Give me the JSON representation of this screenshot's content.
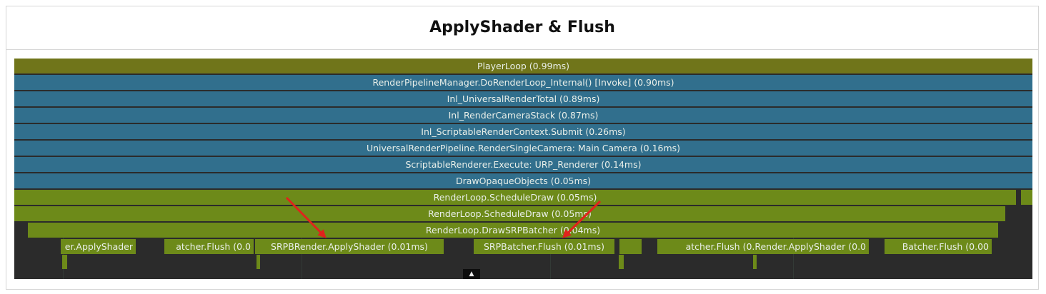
{
  "title": "ApplyShader & Flush",
  "profiler": {
    "rows": [
      {
        "label": "PlayerLoop (0.99ms)"
      },
      {
        "label": "RenderPipelineManager.DoRenderLoop_Internal() [Invoke] (0.90ms)"
      },
      {
        "label": "Inl_UniversalRenderTotal (0.89ms)"
      },
      {
        "label": "Inl_RenderCameraStack (0.87ms)"
      },
      {
        "label": "Inl_ScriptableRenderContext.Submit (0.26ms)"
      },
      {
        "label": "UniversalRenderPipeline.RenderSingleCamera: Main Camera (0.16ms)"
      },
      {
        "label": "ScriptableRenderer.Execute: URP_Renderer (0.14ms)"
      },
      {
        "label": "DrawOpaqueObjects (0.05ms)"
      },
      {
        "label": "RenderLoop.ScheduleDraw (0.05ms)"
      },
      {
        "label": "RenderLoop.ScheduleDraw (0.05ms)"
      },
      {
        "label": "RenderLoop.DrawSRPBatcher (0.04ms)"
      }
    ],
    "leaf_bars": [
      {
        "label": "er.ApplyShader"
      },
      {
        "label": "atcher.Flush (0.0"
      },
      {
        "label": "SRPBRender.ApplyShader (0.01ms)"
      },
      {
        "label": "SRPBatcher.Flush (0.01ms)"
      },
      {
        "label": ""
      },
      {
        "label": "atcher.Flush (0.Render.ApplyShader (0.0"
      },
      {
        "label": "Batcher.Flush (0.00"
      }
    ],
    "colors": {
      "background": "#2b2b2b",
      "player_loop": "#70751a",
      "render_pipeline": "#316f8d",
      "render_loop": "#6d8a19",
      "arrow": "#e0231c"
    },
    "expand_icon": "triangle-up-icon",
    "expand_glyph": "▲"
  }
}
